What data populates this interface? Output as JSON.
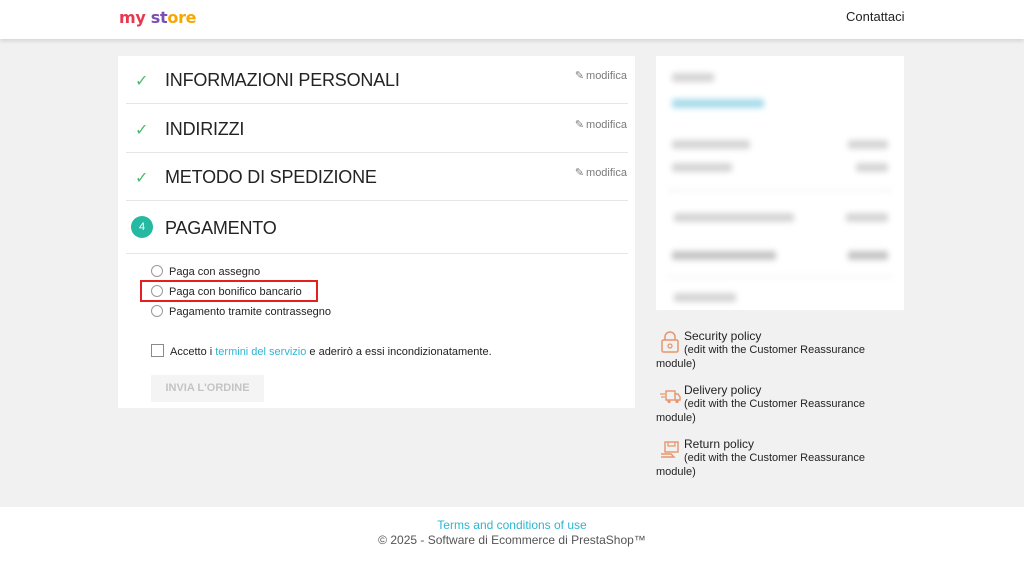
{
  "header": {
    "logo_parts": [
      "my",
      " ",
      "st",
      "ore"
    ],
    "contact_label": "Contattaci"
  },
  "checkout": {
    "steps": [
      {
        "title": "INFORMAZIONI PERSONALI",
        "edit_label": "modifica",
        "status": "complete"
      },
      {
        "title": "INDIRIZZI",
        "edit_label": "modifica",
        "status": "complete"
      },
      {
        "title": "METODO DI SPEDIZIONE",
        "edit_label": "modifica",
        "status": "complete"
      }
    ],
    "payment": {
      "step_number": "4",
      "title": "PAGAMENTO",
      "options": [
        {
          "label": "Paga con assegno",
          "selected": false
        },
        {
          "label": "Paga con bonifico bancario",
          "selected": false,
          "highlighted": true
        },
        {
          "label": "Pagamento tramite contrassegno",
          "selected": false
        }
      ],
      "terms_prefix": "Accetto i ",
      "terms_link": "termini del servizio",
      "terms_suffix": " e aderirò a essi incondizionatamente.",
      "terms_checked": false,
      "order_button": "INVIA L'ORDINE"
    }
  },
  "reassurance": [
    {
      "icon": "lock-icon",
      "title": "Security policy",
      "line1": "(edit with the Customer Reassurance",
      "line2": "module)"
    },
    {
      "icon": "truck-icon",
      "title": "Delivery policy",
      "line1": "(edit with the Customer Reassurance",
      "line2": "module)"
    },
    {
      "icon": "return-box-icon",
      "title": "Return policy",
      "line1": "(edit with the Customer Reassurance",
      "line2": "module)"
    }
  ],
  "footer": {
    "terms_link": "Terms and conditions of use",
    "copyright": "© 2025 - Software di Ecommerce di PrestaShop™"
  },
  "colors": {
    "accent": "#2fb5d2",
    "check": "#4cbb6c",
    "step_badge": "#24b9a0",
    "highlight_border": "#e3201b"
  }
}
